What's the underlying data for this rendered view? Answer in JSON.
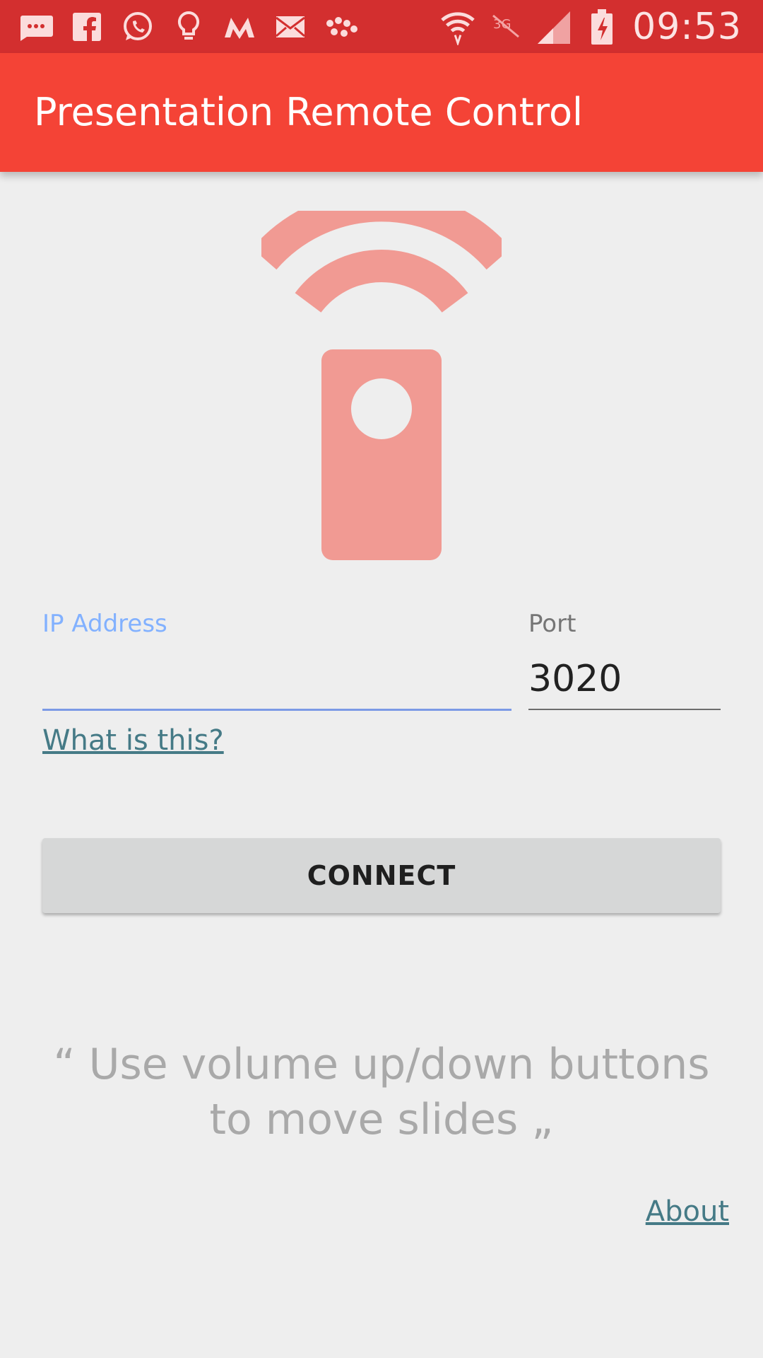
{
  "status_bar": {
    "time": "09:53",
    "left_icons": [
      "message-icon",
      "facebook-icon",
      "whatsapp-icon",
      "lightbulb-icon",
      "myntra-icon",
      "mail-icon",
      "app-grid-icon"
    ],
    "right_icons": [
      "wifi-icon",
      "mobile-data-off-icon",
      "signal-icon",
      "battery-charging-icon"
    ]
  },
  "app_bar": {
    "title": "Presentation Remote Control"
  },
  "hero": {
    "icon": "remote-control-icon",
    "color": "#f19a93"
  },
  "form": {
    "ip_label": "IP Address",
    "ip_value": "",
    "port_label": "Port",
    "port_value": "3020",
    "help_link": "What is this?",
    "connect_label": "CONNECT"
  },
  "hint": "“ Use volume up/down buttons to move slides „",
  "footer": {
    "about_link": "About"
  },
  "colors": {
    "status_bar": "#d32f2f",
    "app_bar": "#f44336",
    "background": "#eeeeee",
    "link": "#457a86",
    "ip_label_focused": "#82b1ff"
  }
}
